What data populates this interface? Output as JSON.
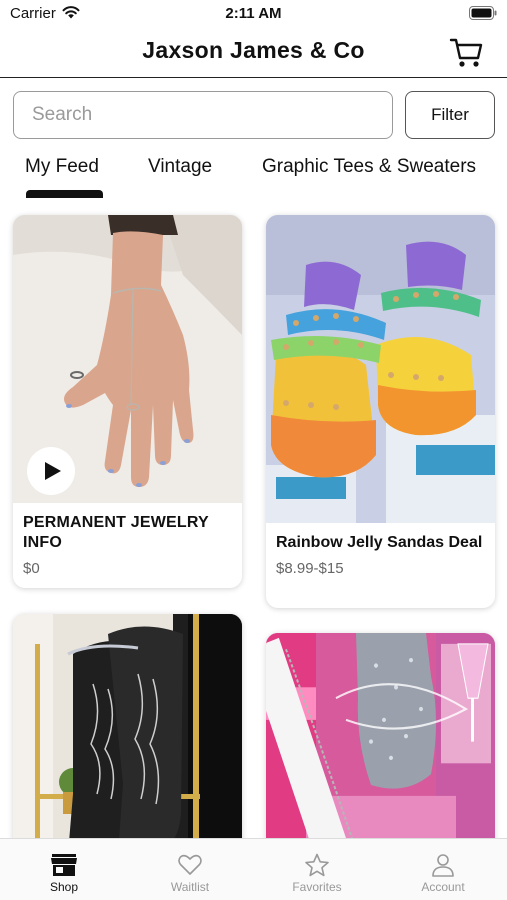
{
  "status_bar": {
    "carrier": "Carrier",
    "time": "2:11 AM"
  },
  "header": {
    "title": "Jaxson James & Co",
    "cart_icon": "cart-icon"
  },
  "search": {
    "placeholder": "Search",
    "value": "",
    "filter_label": "Filter"
  },
  "tabs": [
    {
      "label": "My Feed",
      "active": true
    },
    {
      "label": "Vintage",
      "active": false
    },
    {
      "label": "Graphic Tees & Sweaters",
      "active": false
    }
  ],
  "products": [
    {
      "title": "PERMANENT JEWELRY INFO",
      "price": "$0",
      "has_video": true
    },
    {
      "title": "Rainbow Jelly Sandas Deal",
      "price": "$8.99-$15",
      "has_video": false
    },
    {
      "title": "",
      "price": "",
      "has_video": false
    },
    {
      "title": "",
      "price": "",
      "has_video": false
    }
  ],
  "tabbar": [
    {
      "label": "Shop",
      "icon": "storefront-icon",
      "active": true
    },
    {
      "label": "Waitlist",
      "icon": "heart-icon",
      "active": false
    },
    {
      "label": "Favorites",
      "icon": "star-icon",
      "active": false
    },
    {
      "label": "Account",
      "icon": "person-icon",
      "active": false
    }
  ],
  "colors": {
    "primary": "#111111",
    "inactive": "#999999",
    "border": "#9a9a9a",
    "divider": "#ededed"
  }
}
